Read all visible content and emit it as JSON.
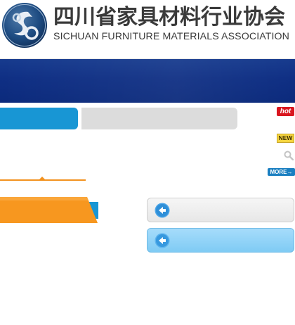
{
  "header": {
    "org_name_cn": "四川省家具材料行业协会",
    "org_name_en": "SICHUAN FURNITURE MATERIALS ASSOCIATION",
    "logo_icon": "association-logo-icon"
  },
  "badges": {
    "hot": "hot",
    "new": "NEW",
    "more": "MORE"
  },
  "icons": {
    "search": "search-icon",
    "more_arrow": "arrow-right-icon",
    "side_arrow": "arrow-left-circle-icon"
  },
  "colors": {
    "banner": "#0f2f84",
    "tab_active": "#1896d4",
    "tab_inactive": "#dcdcdc",
    "accent_orange": "#f2921f",
    "hot_red": "#d9161f",
    "side_button_active": "#8fd2f7"
  }
}
